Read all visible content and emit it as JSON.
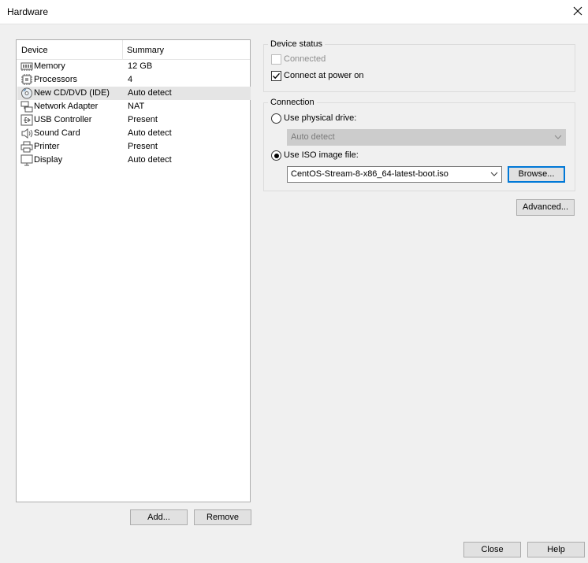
{
  "window": {
    "title": "Hardware",
    "close_icon": "close-icon"
  },
  "device_list": {
    "columns": [
      "Device",
      "Summary"
    ],
    "rows": [
      {
        "name": "Memory",
        "summary": "12 GB",
        "icon": "memory-icon",
        "selected": false
      },
      {
        "name": "Processors",
        "summary": "4",
        "icon": "processor-icon",
        "selected": false
      },
      {
        "name": "New CD/DVD (IDE)",
        "summary": "Auto detect",
        "icon": "cd-dvd-icon",
        "selected": true
      },
      {
        "name": "Network Adapter",
        "summary": "NAT",
        "icon": "network-adapter-icon",
        "selected": false
      },
      {
        "name": "USB Controller",
        "summary": "Present",
        "icon": "usb-icon",
        "selected": false
      },
      {
        "name": "Sound Card",
        "summary": "Auto detect",
        "icon": "speaker-icon",
        "selected": false
      },
      {
        "name": "Printer",
        "summary": "Present",
        "icon": "printer-icon",
        "selected": false
      },
      {
        "name": "Display",
        "summary": "Auto detect",
        "icon": "monitor-icon",
        "selected": false
      }
    ],
    "add_label": "Add...",
    "remove_label": "Remove"
  },
  "device_status": {
    "title": "Device status",
    "connected_label": "Connected",
    "connected_checked": false,
    "connected_enabled": false,
    "power_on_label": "Connect at power on",
    "power_on_checked": true
  },
  "connection": {
    "title": "Connection",
    "physical_label": "Use physical drive:",
    "physical_selected": false,
    "physical_value": "Auto detect",
    "iso_label": "Use ISO image file:",
    "iso_selected": true,
    "iso_value": "CentOS-Stream-8-x86_64-latest-boot.iso",
    "browse_label": "Browse..."
  },
  "advanced_label": "Advanced...",
  "footer": {
    "close_label": "Close",
    "help_label": "Help"
  }
}
